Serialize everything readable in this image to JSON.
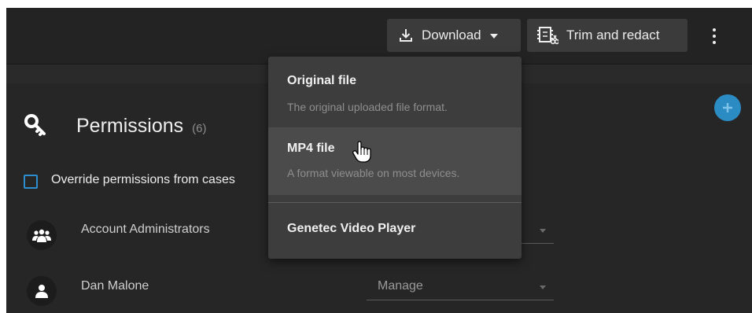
{
  "toolbar": {
    "download_label": "Download",
    "trim_label": "Trim and redact",
    "icons": {
      "download": "download-icon",
      "caret": "caret-down-icon",
      "trim": "film-scissors-icon",
      "more": "more-vertical-icon"
    }
  },
  "download_menu": {
    "items": [
      {
        "title": "Original file",
        "description": "The original uploaded file format."
      },
      {
        "title": "MP4 file",
        "description": "A format viewable on most devices."
      },
      {
        "title": "Genetec Video Player"
      }
    ],
    "hovered_item": "MP4 file"
  },
  "permissions": {
    "title": "Permissions",
    "count": "(6)",
    "override_label": "Override permissions from cases",
    "override_checked": false,
    "add_icon": "plus-icon",
    "users": [
      {
        "name": "Account Administrators",
        "avatar": "group-icon",
        "role": ""
      },
      {
        "name": "Dan Malone",
        "avatar": "user-icon",
        "role": "Manage"
      }
    ]
  },
  "colors": {
    "accent": "#2b8cc4",
    "background": "#262626",
    "menu_background": "#3d3d3d",
    "menu_hover": "#4b4b4b"
  }
}
